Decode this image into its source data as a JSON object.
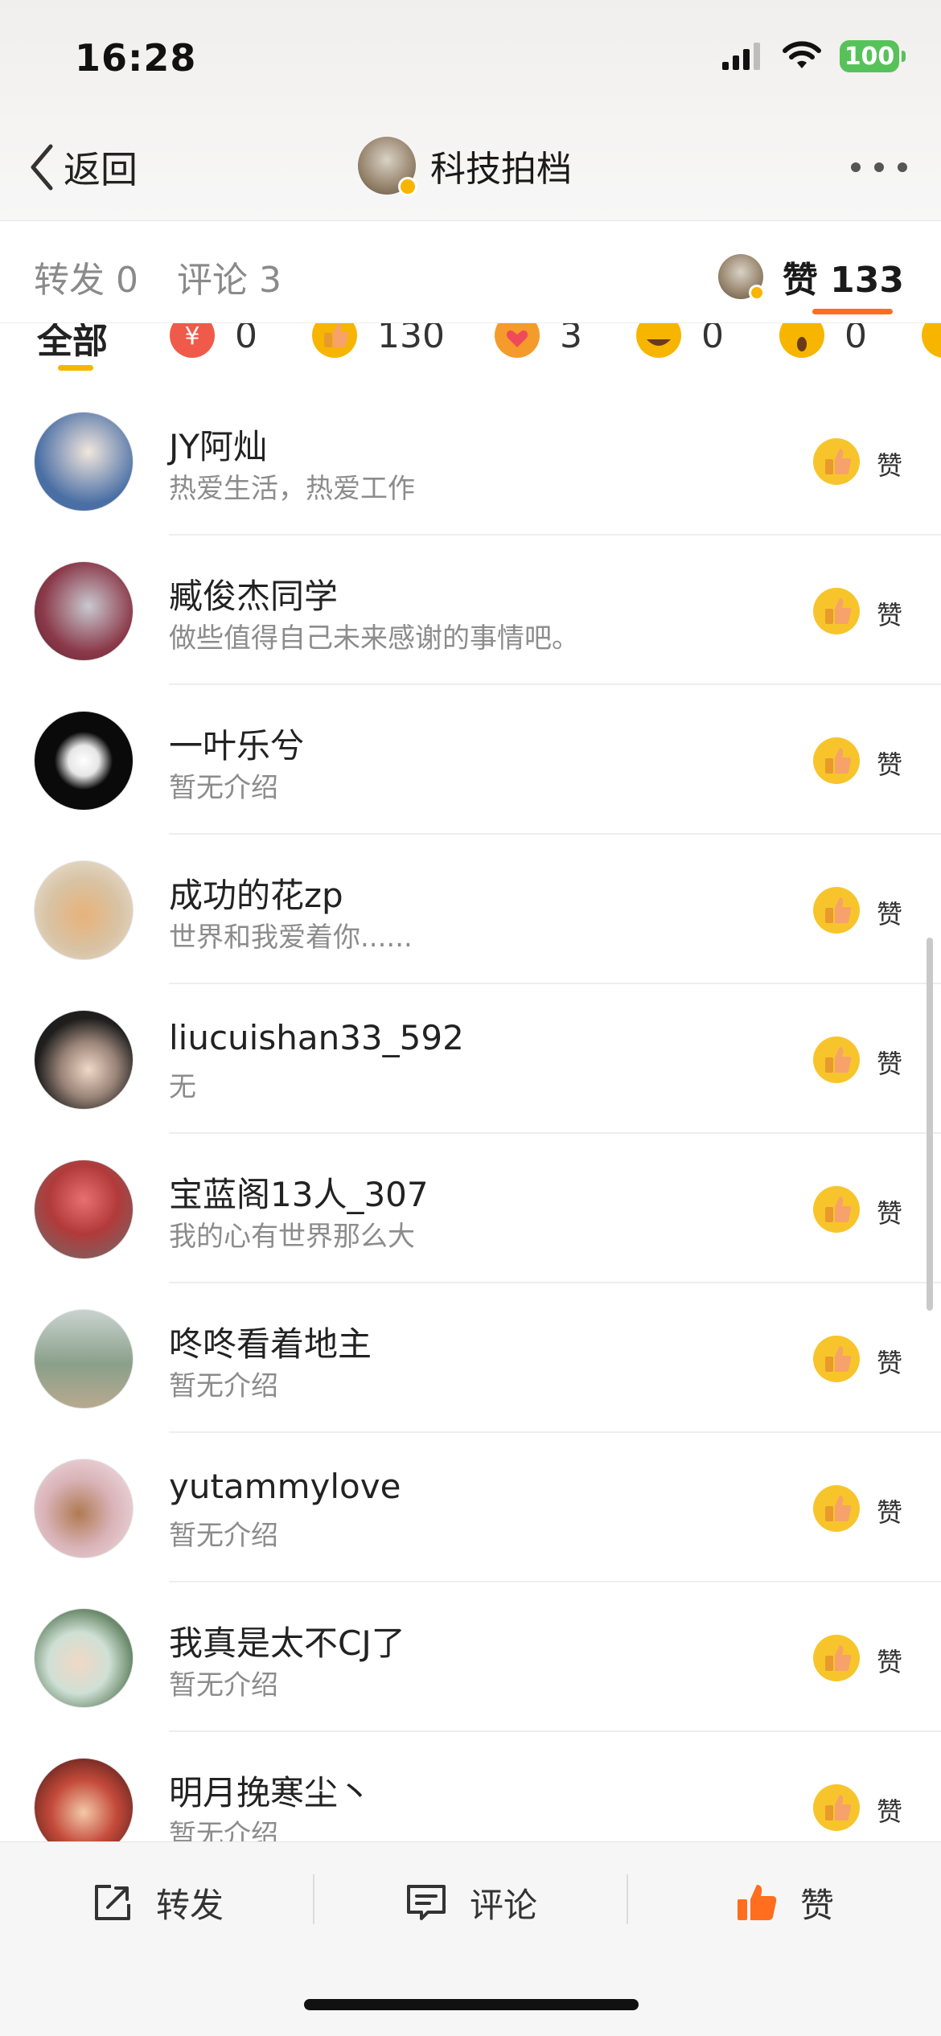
{
  "status_bar": {
    "time": "16:28",
    "battery": "100"
  },
  "header": {
    "back_label": "返回",
    "title": "科技拍档"
  },
  "tabs": {
    "repost": "转发 0",
    "comment": "评论 3",
    "like": "赞 133"
  },
  "reactions": [
    {
      "label": "全部"
    },
    {
      "icon": "red-envelope-icon",
      "count": "0",
      "color": "#f05a4a"
    },
    {
      "icon": "thumbs-up-icon",
      "count": "130",
      "color": "#f7b500"
    },
    {
      "icon": "heart-face-icon",
      "count": "3",
      "color": "#f59b2b"
    },
    {
      "icon": "laugh-face-icon",
      "count": "0",
      "color": "#f7b500"
    },
    {
      "icon": "surprise-face-icon",
      "count": "0",
      "color": "#f7b500"
    }
  ],
  "users": [
    {
      "name": "JY阿灿",
      "bio": "热爱生活，热爱工作",
      "avatar_color": "#4a6fa5",
      "like_label": "赞"
    },
    {
      "name": "臧俊杰同学",
      "bio": "做些值得自己未来感谢的事情吧。",
      "avatar_color": "#8b3a4a",
      "like_label": "赞"
    },
    {
      "name": "一叶乐兮",
      "bio": "暂无介绍",
      "avatar_color": "#0a0a0a",
      "like_label": "赞"
    },
    {
      "name": "成功的花zp",
      "bio": "世界和我爱着你......",
      "avatar_color": "#d8c3a5",
      "like_label": "赞"
    },
    {
      "name": "liucuishan33_592",
      "bio": "无",
      "avatar_color": "#3a3a3a",
      "like_label": "赞"
    },
    {
      "name": "宝蓝阁13人_307",
      "bio": "我的心有世界那么大",
      "avatar_color": "#b23a3a",
      "like_label": "赞"
    },
    {
      "name": "咚咚看着地主",
      "bio": "暂无介绍",
      "avatar_color": "#8aa08a",
      "like_label": "赞"
    },
    {
      "name": "yutammylove",
      "bio": "暂无介绍",
      "avatar_color": "#d9b3b8",
      "like_label": "赞"
    },
    {
      "name": "我真是太不CJ了",
      "bio": "暂无介绍",
      "avatar_color": "#6b8a6b",
      "like_label": "赞"
    },
    {
      "name": "明月挽寒尘丶",
      "bio": "暂无介绍",
      "avatar_color": "#7a2a2a",
      "like_label": "赞"
    }
  ],
  "bottom_bar": {
    "repost": "转发",
    "comment": "评论",
    "like": "赞"
  },
  "colors": {
    "accent": "#ff6d1e",
    "like_yellow": "#f7b500"
  }
}
